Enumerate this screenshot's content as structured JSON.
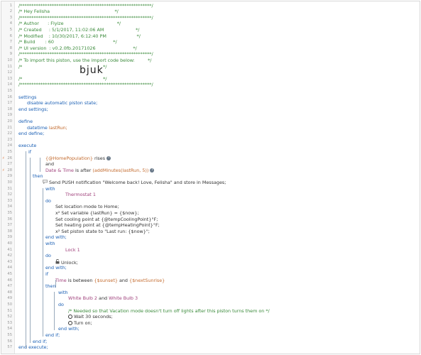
{
  "gutter": {
    "line_numbers": [
      "1",
      "2",
      "3",
      "4",
      "5",
      "6",
      "7",
      "8",
      "9",
      "10",
      "11",
      "12",
      "13",
      "14",
      "15",
      "16",
      "17",
      "18",
      "19",
      "20",
      "21",
      "22",
      "23",
      "24",
      "25",
      "26",
      "27",
      "28",
      "29",
      "30",
      "31",
      "32",
      "33",
      "34",
      "35",
      "36",
      "37",
      "38",
      "39",
      "40",
      "41",
      "42",
      "43",
      "44",
      "45",
      "46",
      "47",
      "48",
      "49",
      "50",
      "51",
      "52",
      "53",
      "54",
      "55",
      "56",
      "57"
    ],
    "markers": {
      "26": "⚡",
      "28": "⚡"
    }
  },
  "header": {
    "stars_open": "/**********************************************************/",
    "title": "/* Hey Felisha                                             */",
    "stars_mid": "/**********************************************************/",
    "author": "/* Author      : Flyize                                     */",
    "created": "/* Created     : 5/1/2017, 11:02:06 AM                      */",
    "modified": "/* Modified    : 10/30/2017, 6:12:40 PM                     */",
    "build": "/* Build       : 60                                         */",
    "ui_version": "/* UI version  : v0.2.0fb.20171026                          */",
    "stars_mid2": "/**********************************************************/",
    "import_note": "/* To import this piston, use the import code below:         */",
    "blank1": "/*                                                        */",
    "import_code": "bjuk",
    "blank2": "/*                                                        */",
    "stars_close": "/**********************************************************/"
  },
  "settings": {
    "open": "settings",
    "body": "disable automatic piston state;",
    "close": "end settings;"
  },
  "define": {
    "open": "define",
    "type": "datetime",
    "name": "lastRun;",
    "close": "end define;"
  },
  "execute": {
    "open": "execute",
    "if_kw": "if",
    "cond1_var": "{@HomePopulation}",
    "cond1_op": "rises",
    "and_kw": "and",
    "cond2_subject": "Date & Time",
    "cond2_op": "is after",
    "cond2_expr": "(addMinutes(lastRun, 5))",
    "then_kw": "then",
    "push_text": "Send PUSH notification \"Welcome back! Love, Felisha\" and store in Messages;",
    "with1": "with",
    "thermostat": "Thermostat 1",
    "do1": "do",
    "act_location": "Set location mode to Home;",
    "act_variable": "Set variable {lastRun} = {$now};",
    "act_cooling": "Set cooling point at {@tempCoolingPoint}°F;",
    "act_heating": "Set heating point at {@tempHeatingPoint}°F;",
    "act_state": "Set piston state to \"Last run: {$now}\";",
    "endwith1": "end with;",
    "with2": "with",
    "lock": "Lock 1",
    "do2": "do",
    "unlock": "Unlock;",
    "endwith2": "end with;",
    "if2": "if",
    "time_subject": "Time",
    "time_op": "is between",
    "time_a": "{$sunset}",
    "time_and": "and",
    "time_b": "{$nextSunrise}",
    "then2": "then",
    "with3": "with",
    "bulb_a": "White Bulb 2",
    "bulb_and": "and",
    "bulb_b": "White Bulb 3",
    "do3": "do",
    "comment": "/* Needed so that Vacation mode doesn't turn off lights after this piston turns them on */",
    "wait": "Wait 30 seconds;",
    "turn_on": "Turn on;",
    "endwith3": "end with;",
    "endif2": "end if;",
    "endif1": "end if;",
    "close": "end execute;"
  }
}
